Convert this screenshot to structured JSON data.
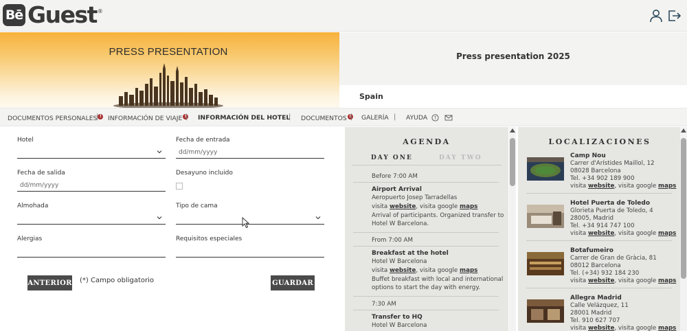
{
  "header": {
    "logo_box": "Bē",
    "logo_text": "Guest",
    "logo_reg": "®",
    "icons": [
      "user-icon",
      "logout-icon"
    ]
  },
  "banner": {
    "title": "PRESS PRESENTATION",
    "event_title": "Press presentation 2025",
    "country": "Spain",
    "gradient_colors": [
      "#f7b13c",
      "#fdf3de"
    ]
  },
  "nav": {
    "items": [
      {
        "label": "DOCUMENTOS PERSONALES",
        "badge": "!"
      },
      {
        "label": "INFORMACIÓN DE VIAJE",
        "badge": "!"
      },
      {
        "label": "INFORMACIÓN DEL HOTEL",
        "active": true
      },
      {
        "label": "DOCUMENTOS",
        "badge": "!"
      },
      {
        "label": "GALERÍA"
      },
      {
        "label": "AYUDA"
      }
    ],
    "separator": "|",
    "icons": [
      "help-icon",
      "mail-icon"
    ]
  },
  "form": {
    "hotel_label": "Hotel",
    "checkin_label": "Fecha de entrada",
    "checkin_placeholder": "dd/mm/yyyy",
    "checkout_label": "Fecha de salida",
    "checkout_placeholder": "dd/mm/yyyy",
    "breakfast_label": "Desayuno incluido",
    "pillow_label": "Almohada",
    "bed_label": "Tipo de cama",
    "allergies_label": "Alergias",
    "special_label": "Requisitos especiales",
    "back_button": "ANTERIOR",
    "save_button": "GUARDAR",
    "required_note": "(*) Campo obligatorio"
  },
  "agenda": {
    "title": "AGENDA",
    "tabs": [
      "DAY ONE",
      "DAY TWO"
    ],
    "events": [
      {
        "time": "Before 7:00 AM",
        "title": "Airport Arrival",
        "place": "Aeropuerto Josep Tarradellas",
        "visit_prefix": "visita ",
        "website": "website",
        "google": ", visita google ",
        "maps": "maps",
        "desc1": "Arrival of participants. Organized transfer to",
        "desc2": "Hotel W Barcelona."
      },
      {
        "time": "From 7:00 AM",
        "title": "Breakfast at the hotel",
        "place": "Hotel W Barcelona",
        "visit_prefix": "visita ",
        "website": "website",
        "google": ", visita google ",
        "maps": "maps",
        "desc1": "Buffet breakfast with local and international",
        "desc2": "options to start the day with energy."
      },
      {
        "time": "7:30 AM",
        "title": "Transfer to HQ",
        "place": "Hotel W Barcelona"
      }
    ]
  },
  "locations": {
    "title": "LOCALIZACIONES",
    "items": [
      {
        "name": "Camp Nou",
        "addr1": "Carrer d'Arístides Maillol, 12",
        "addr2": "08028 Barcelona",
        "tel": "Tel. +34 902 189 900",
        "visit_prefix": "visita ",
        "website": "website",
        "google": ", visita google ",
        "maps": "maps",
        "thumb_color": "#3b5a7a"
      },
      {
        "name": "Hotel Puerta de Toledo",
        "addr1": "Glorieta Puerta de Toledo, 4",
        "addr2": "28005, Madrid",
        "tel": "Tel. +34 914 747 100",
        "visit_prefix": "visita ",
        "website": "website",
        "google": ", visita google ",
        "maps": "maps",
        "thumb_color": "#7a6d5e"
      },
      {
        "name": "Botafumeiro",
        "addr1": "Carrer de Gran de Gràcia, 81",
        "addr2": "08012 Barcelona",
        "tel": "Tel. (+34) 932 184 230",
        "visit_prefix": "visita ",
        "website": "website",
        "google": ", visita google ",
        "maps": "maps",
        "thumb_color": "#6b4a2a"
      },
      {
        "name": "Allegra Madrid",
        "addr1": "Calle Velázquez, 11",
        "addr2": "28001 Madrid",
        "tel": "Tel. 910 627 707",
        "visit_prefix": "visita ",
        "website": "website",
        "google": ", visita google ",
        "maps": "maps",
        "thumb_color": "#5a3f2c"
      }
    ]
  }
}
